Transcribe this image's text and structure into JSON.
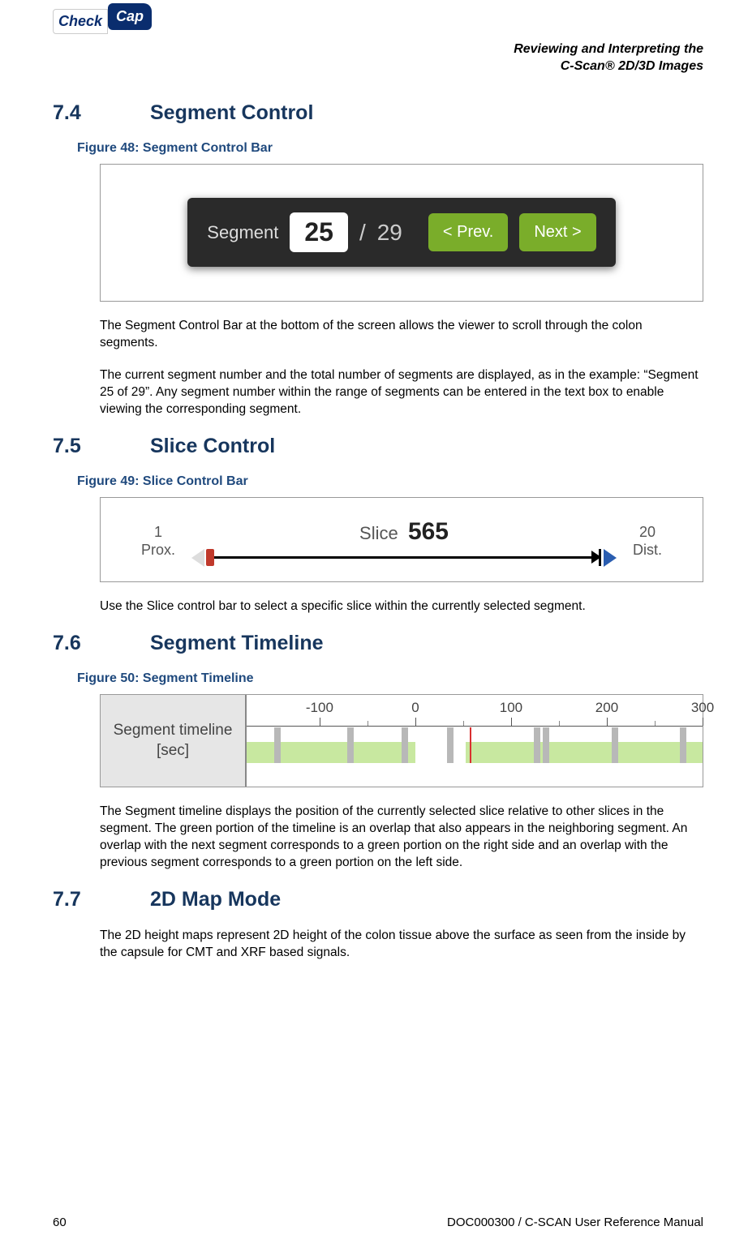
{
  "logo": {
    "part1": "Check",
    "part2": "Cap"
  },
  "header": {
    "line1": "Reviewing and Interpreting the",
    "line2": "C-Scan® 2D/3D Images"
  },
  "sections": {
    "s74": {
      "num": "7.4",
      "title": "Segment Control"
    },
    "s75": {
      "num": "7.5",
      "title": "Slice Control"
    },
    "s76": {
      "num": "7.6",
      "title": "Segment Timeline"
    },
    "s77": {
      "num": "7.7",
      "title": "2D Map Mode"
    }
  },
  "figures": {
    "f48": "Figure 48: Segment Control Bar",
    "f49": "Figure 49: Slice Control Bar",
    "f50": "Figure 50: Segment Timeline"
  },
  "segbar": {
    "label": "Segment",
    "current": "25",
    "slash": "/",
    "total": "29",
    "prev": "< Prev.",
    "next": "Next >"
  },
  "slicebar": {
    "left_num": "1",
    "left_label": "Prox.",
    "title_prefix": "Slice",
    "value": "565",
    "right_num": "20",
    "right_label": "Dist."
  },
  "timeline": {
    "label_l1": "Segment timeline",
    "label_l2": "[sec]",
    "ticks": [
      "-100",
      "0",
      "100",
      "200",
      "300"
    ]
  },
  "paras": {
    "p1": "The Segment Control Bar at the bottom of the screen allows the viewer to scroll through the colon segments.",
    "p2": "The current segment number and the total number of segments are displayed, as in the example: “Segment 25 of 29”. Any segment number within the range of segments can be entered in the text box to enable viewing the corresponding segment.",
    "p3": "Use the Slice control bar to select a specific slice within the currently selected segment.",
    "p4": "The Segment timeline displays the position of the currently selected slice relative to other slices in the segment. The green portion of the timeline is an overlap that also appears in the neighboring segment. An overlap with the next segment corresponds to a green portion on the right side and an overlap with the previous segment corresponds to a green portion on the left side.",
    "p5": "The 2D height maps represent 2D height of the colon tissue above the surface as seen from the inside by the capsule for CMT and XRF based signals."
  },
  "footer": {
    "page": "60",
    "doc": "DOC000300 / C-SCAN User Reference Manual"
  }
}
